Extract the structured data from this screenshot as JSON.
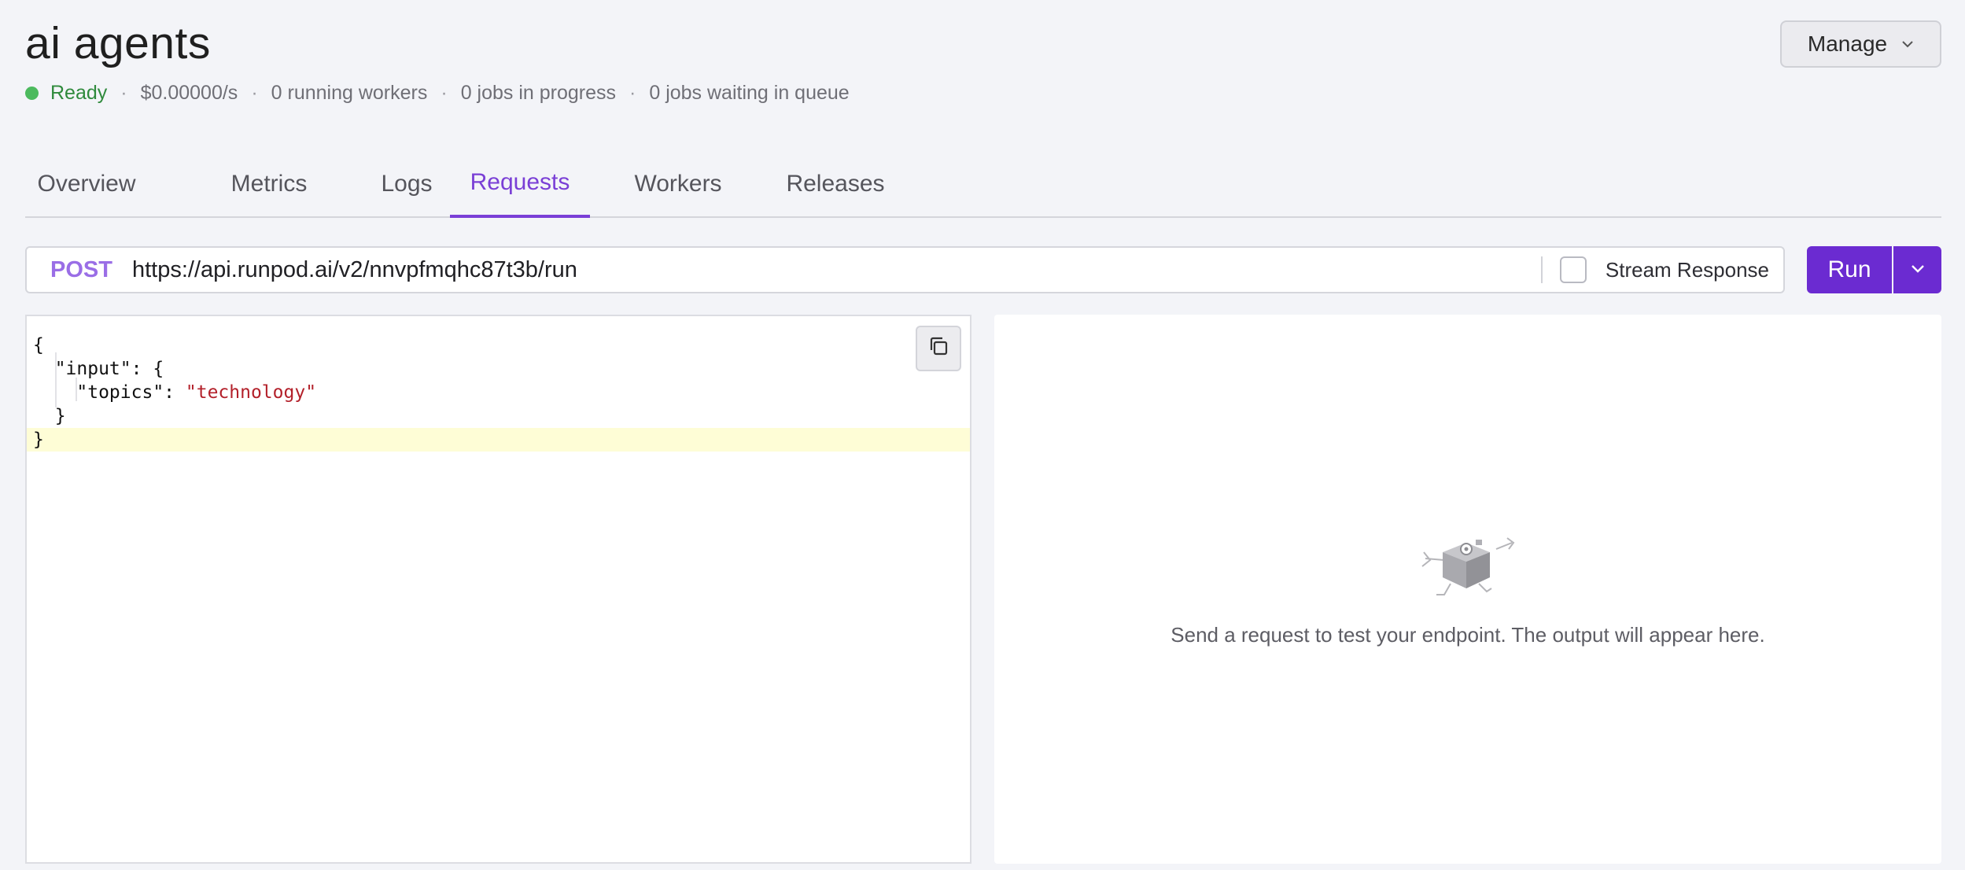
{
  "header": {
    "title": "ai agents",
    "status": {
      "state": "Ready",
      "cost": "$0.00000/s",
      "running_workers": "0 running workers",
      "jobs_in_progress": "0 jobs in progress",
      "jobs_in_queue": "0 jobs waiting in queue",
      "separator": "·"
    },
    "manage_label": "Manage"
  },
  "tabs": [
    {
      "label": "Overview",
      "active": false
    },
    {
      "label": "Metrics",
      "active": false
    },
    {
      "label": "Logs",
      "active": false
    },
    {
      "label": "Requests",
      "active": true
    },
    {
      "label": "Workers",
      "active": false
    },
    {
      "label": "Releases",
      "active": false
    }
  ],
  "request": {
    "method": "POST",
    "url": "https://api.runpod.ai/v2/nnvpfmqhc87t3b/run",
    "stream_label": "Stream Response",
    "stream_checked": false,
    "run_label": "Run"
  },
  "editor": {
    "lines": [
      "{",
      "  \"input\": {",
      "    \"topics\": ",
      "  }",
      "}"
    ],
    "string_value": "\"technology\""
  },
  "output": {
    "empty_message": "Send a request to test your endpoint. The output will appear here."
  },
  "colors": {
    "accent": "#7a3fd6",
    "run_button": "#6b2bd1",
    "status_ready": "#4cba5e",
    "method": "#9a6ee6",
    "json_string": "#b3202a"
  }
}
